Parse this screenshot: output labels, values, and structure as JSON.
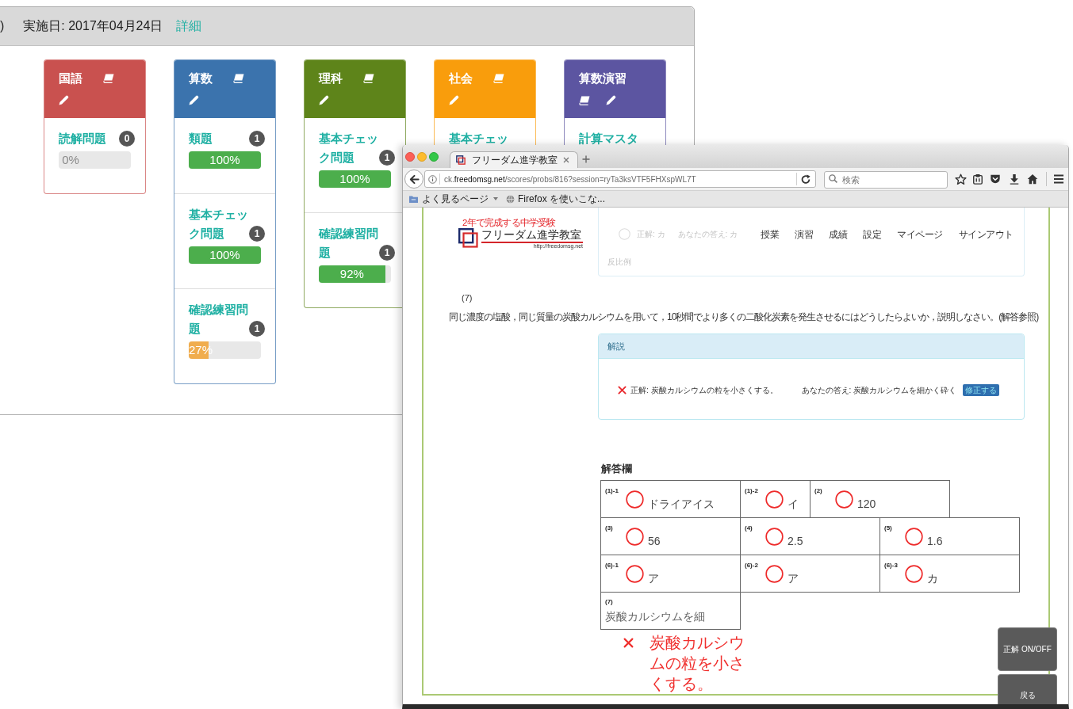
{
  "score_window": {
    "header": {
      "prefix": ")",
      "date": "実施日: 2017年04月24日",
      "link": "詳細"
    },
    "subjects": [
      {
        "title": "国語",
        "color": "#c9514f",
        "items": [
          {
            "title": "読解問題",
            "count": "0",
            "level": 0,
            "reading": "0%"
          }
        ]
      },
      {
        "title": "算数",
        "color": "#3b73ad",
        "items": [
          {
            "title": "類題",
            "count": "1",
            "level": 1,
            "reading": "100%",
            "color": "#4cae4c"
          },
          {
            "title": "基本チェック問題",
            "count": "1",
            "level": 1,
            "reading": "100%",
            "color": "#4cae4c"
          },
          {
            "title": "確認練習問題",
            "count": "1",
            "level": 0.27,
            "reading": "27%",
            "color": "#f0ad4e"
          }
        ]
      },
      {
        "title": "理科",
        "color": "#5e841a",
        "items": [
          {
            "title": "基本チェック問題",
            "count": "1",
            "level": 1,
            "reading": "100%",
            "color": "#4cae4c"
          },
          {
            "title": "確認練習問題",
            "count": "1",
            "level": 0.92,
            "reading": "92%",
            "color": "#4cae4c"
          }
        ]
      },
      {
        "title": "社会",
        "color": "#f99d0c",
        "items": [
          {
            "title": "基本チェッ"
          }
        ]
      },
      {
        "title": "算数演習",
        "color": "#5c55a1",
        "items": [
          {
            "title": "計算マスタ"
          }
        ]
      }
    ]
  },
  "browser": {
    "tab_title": "フリーダム進学教室",
    "url": "ck.**freedomsg.net**/scores/probs/816?session=ryTa3ksVTF5FHXspWL7T",
    "search": {
      "placeholder": "検索"
    },
    "bookmarks": [
      {
        "kind": "folder",
        "label": "よく見るページ"
      },
      {
        "kind": "page",
        "label": "Firefox を使いこな..."
      }
    ],
    "page": {
      "logo": {
        "tagline": "2年で完成する中学受験",
        "name": "フリーダム進学教室",
        "url": "http://freedomsg.net"
      },
      "nav": [
        "授業",
        "演習",
        "成績",
        "設定",
        "マイページ",
        "サインアウト"
      ],
      "previous_explanation": {
        "correct": true,
        "correct_text": "正解: カ",
        "answer_text": "あなたの答え: カ",
        "note": "反比例"
      },
      "question": {
        "number": "(7)",
        "text": "同じ濃度の塩酸，同じ質量の炭酸カルシウムを用いて，10秒間でより多くの二酸化炭素を発生させるにはどうしたらよいか，説明しなさい。(解答参照)"
      },
      "explanation": {
        "title": "解説",
        "correct": false,
        "correct_text": "正解: 炭酸カルシウムの粒を小さくする。",
        "answer_text": "あなたの答え: 炭酸カルシウムを細かく砕く",
        "button": "修正する"
      },
      "answer_sheet": {
        "title": "解答欄",
        "rows": [
          {
            "cells": [
              {
                "label": "(1)-1",
                "value": "ドライアイス",
                "correct": true
              },
              {
                "label": "(1)-2",
                "value": "イ",
                "correct": true
              },
              {
                "label": "(2)",
                "value": "120",
                "correct": true
              }
            ]
          },
          {
            "cells": [
              {
                "label": "(3)",
                "value": "56",
                "correct": true
              },
              {
                "label": "(4)",
                "value": "2.5",
                "correct": true
              },
              {
                "label": "(5)",
                "value": "1.6",
                "correct": true
              }
            ]
          },
          {
            "cells": [
              {
                "label": "(6)-1",
                "value": "ア",
                "correct": true
              },
              {
                "label": "(6)-2",
                "value": "ア",
                "correct": true
              },
              {
                "label": "(6)-3",
                "value": "カ",
                "correct": true
              }
            ]
          },
          {
            "cells": [
              {
                "label": "(7)",
                "value": "炭酸カルシウムを細",
                "correct": false,
                "correction": "炭酸カルシウムの粒を小さくする。"
              }
            ]
          }
        ]
      },
      "buttons": [
        "正解 ON/OFF",
        "戻る"
      ]
    }
  }
}
